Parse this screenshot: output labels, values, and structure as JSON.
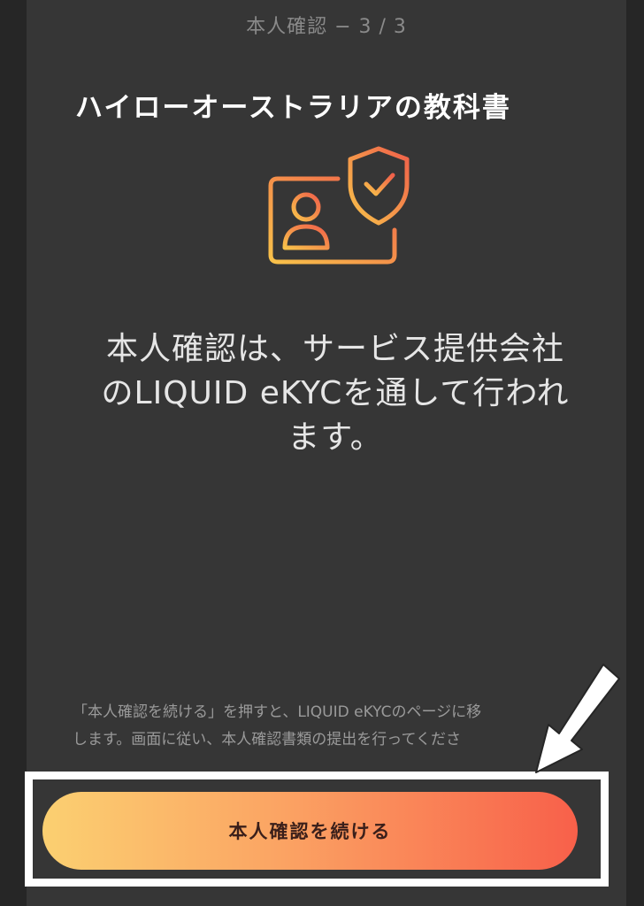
{
  "header": {
    "step_label": "本人確認 − 3 / 3"
  },
  "watermark": {
    "text": "ハイローオーストラリアの教科書"
  },
  "hero": {
    "icon": "id-card-shield-check-icon",
    "gradient_start": "#f8c24a",
    "gradient_end": "#f0604a"
  },
  "headline": {
    "line1": "本人確認は、サービス提供会社",
    "line2": "のLIQUID eKYCを通して行われ",
    "line3": "ます。"
  },
  "note": {
    "line1": "「本人確認を続ける」を押すと、LIQUID eKYCのページに移",
    "line2": "します。画面に従い、本人確認書類の提出を行ってくださ"
  },
  "cta": {
    "label": "本人確認を続ける",
    "gradient": [
      "#fbd071",
      "#fba363",
      "#f8604a"
    ]
  },
  "annotation": {
    "arrow_icon": "white-arrow-down-left-icon",
    "box_color": "#ffffff"
  }
}
